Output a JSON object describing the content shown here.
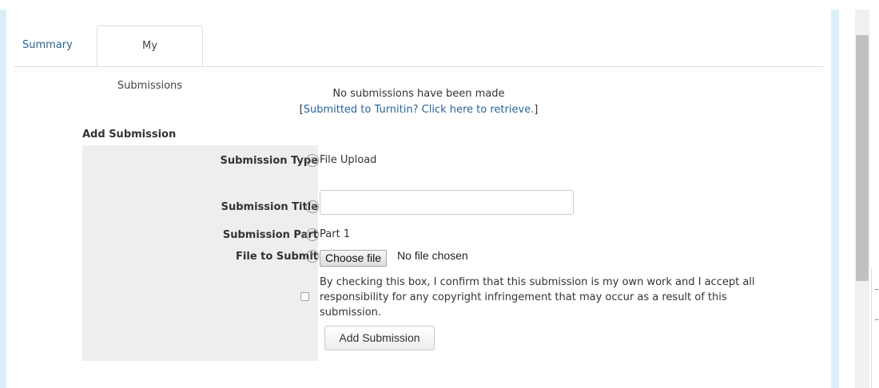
{
  "tabs": [
    {
      "label": "Summary"
    },
    {
      "label": "My Submissions"
    }
  ],
  "notice": {
    "message": "No submissions have been made",
    "retrieve_prefix": "[",
    "retrieve_link": "Submitted to Turnitin? Click here to retrieve.",
    "retrieve_suffix": "]"
  },
  "form": {
    "heading": "Add Submission",
    "help_glyph": "?",
    "submission_type": {
      "label": "Submission Type",
      "value": "File Upload"
    },
    "submission_title": {
      "label": "Submission Title",
      "value": ""
    },
    "submission_part": {
      "label": "Submission Part",
      "value": "Part 1"
    },
    "file_to_submit": {
      "label": "File to Submit",
      "button": "Choose file",
      "status": "No file chosen"
    },
    "agreement": "By checking this box, I confirm that this submission is my own work and I accept all responsibility for any copyright infringement that may occur as a result of this submission.",
    "agreement_checked": false,
    "submit_label": "Add Submission"
  },
  "colors": {
    "link": "#2a6496",
    "frame_border": "#dbeffa",
    "label_panel": "#eeeeee"
  }
}
